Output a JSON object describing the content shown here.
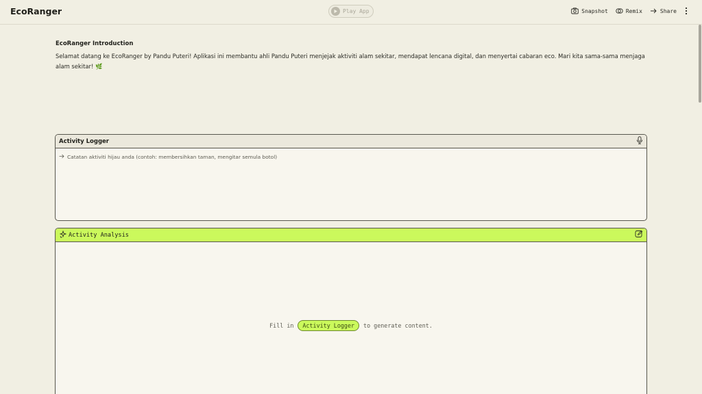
{
  "header": {
    "app_title": "EcoRanger",
    "play_label": "Play App",
    "actions": [
      {
        "label": "Snapshot",
        "icon": "camera-icon"
      },
      {
        "label": "Remix",
        "icon": "remix-icon"
      },
      {
        "label": "Share",
        "icon": "share-arrow-icon"
      }
    ]
  },
  "intro": {
    "title": "EcoRanger Introduction",
    "text": "Selamat datang ke EcoRanger by Pandu Puteri! Aplikasi ini membantu ahli Pandu Puteri menjejak aktiviti alam sekitar, mendapat lencana digital, dan menyertai cabaran eco. Mari kita sama-sama menjaga alam sekitar! 🌿"
  },
  "logger": {
    "title": "Activity Logger",
    "placeholder": "Catatan aktiviti hijau anda (contoh: membersihkan taman, mengitar semula botol)"
  },
  "analysis": {
    "title": "Activity Analysis",
    "empty_prefix": "Fill in",
    "empty_chip": "Activity Logger",
    "empty_suffix": "to generate content."
  },
  "colors": {
    "background": "#f1efe3",
    "accent": "#cbf95c",
    "border": "#57564d"
  }
}
